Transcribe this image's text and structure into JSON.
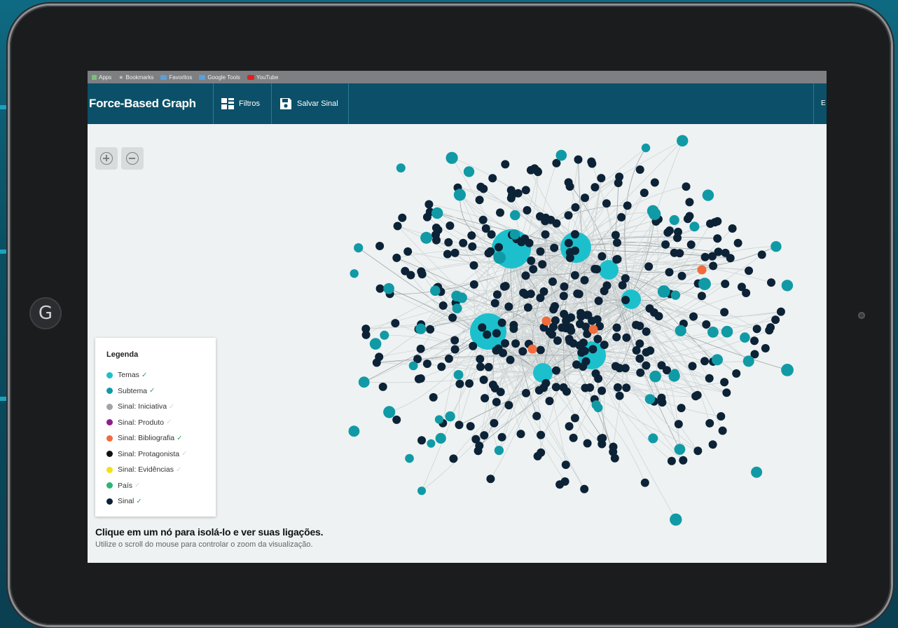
{
  "bookmarks": [
    {
      "label": "Apps",
      "icon": "apps-icon"
    },
    {
      "label": "Bookmarks",
      "icon": "star-icon"
    },
    {
      "label": "Favoritos",
      "icon": "folder-icon"
    },
    {
      "label": "Google Tools",
      "icon": "folder-icon"
    },
    {
      "label": "YouTube",
      "icon": "youtube-icon"
    }
  ],
  "header": {
    "title": "Force-Based Graph",
    "filters_label": "Filtros",
    "save_label": "Salvar Sinal",
    "right_truncated": "E"
  },
  "legend": {
    "title": "Legenda",
    "items": [
      {
        "label": "Temas",
        "color": "#1cc0cc",
        "checked": true
      },
      {
        "label": "Subtema",
        "color": "#109aa6",
        "checked": true
      },
      {
        "label": "Sinal: Iniciativa",
        "color": "#a0a4a8",
        "checked": false
      },
      {
        "label": "Sinal: Produto",
        "color": "#8e1e8e",
        "checked": false
      },
      {
        "label": "Sinal: Bibliografia",
        "color": "#f26b3a",
        "checked": true
      },
      {
        "label": "Sinal: Protagonista",
        "color": "#111111",
        "checked": false
      },
      {
        "label": "Sinal: Evidências",
        "color": "#f0e21a",
        "checked": false
      },
      {
        "label": "País",
        "color": "#2bb673",
        "checked": false
      },
      {
        "label": "Sinal",
        "color": "#0c2236",
        "checked": true
      }
    ]
  },
  "hint": {
    "title": "Clique em um nó para isolá-lo e ver suas ligações.",
    "subtitle": "Utilize o scroll do mouse para controlar o zoom da visualização."
  },
  "colors": {
    "header_bg": "#0b5068",
    "tema": "#1cc0cc",
    "subtema": "#109aa6",
    "bibliografia": "#f26b3a",
    "sinal": "#0c2236",
    "canvas_bg": "#eef2f2"
  }
}
